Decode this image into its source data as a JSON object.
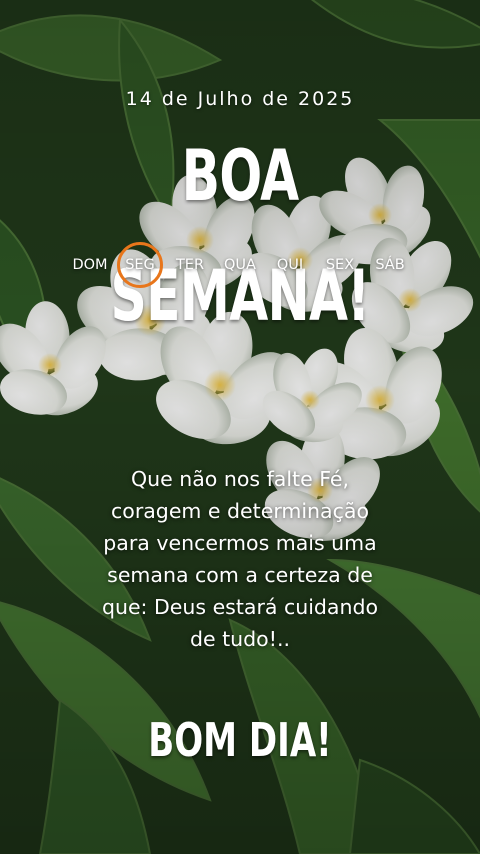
{
  "date_line": "14 de Julho de 2025",
  "headline": "BOA SEMANA!",
  "weekdays": [
    {
      "label": "DOM",
      "selected": false
    },
    {
      "label": "SEG",
      "selected": true
    },
    {
      "label": "TER",
      "selected": false
    },
    {
      "label": "QUA",
      "selected": false
    },
    {
      "label": "QUI",
      "selected": false
    },
    {
      "label": "SEX",
      "selected": false
    },
    {
      "label": "SÁB",
      "selected": false
    }
  ],
  "highlight_color": "#e8761b",
  "message_lines": [
    "Que não nos falte Fé,",
    "coragem e determinação",
    "para vencermos mais uma",
    "semana com a certeza de",
    "que: Deus estará cuidando",
    "de tudo!.."
  ],
  "closing": "BOM DIA!"
}
